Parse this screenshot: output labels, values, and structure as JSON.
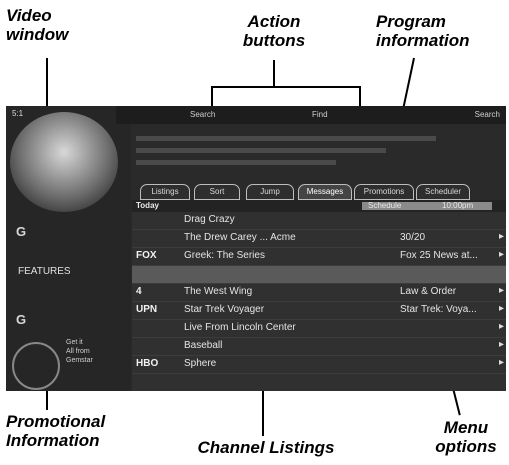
{
  "callouts": {
    "video_window": "Video\nwindow",
    "action_buttons": "Action\nbuttons",
    "program_information": "Program\ninformation",
    "promotional_information": "Promotional\nInformation",
    "channel_listings": "Channel Listings",
    "menu_options": "Menu\noptions"
  },
  "screen": {
    "clock": "5:1",
    "topbar": {
      "left": "Search",
      "middle": "Find",
      "right": "Search"
    },
    "left_panel": {
      "logo_top": "G",
      "features_label": "FEATURES",
      "logo_bottom": "G",
      "promo_text": "Get it\nAll from\nGemstar"
    },
    "tabs": [
      "Listings",
      "Sort",
      "Jump",
      "Messages",
      "Promotions",
      "Scheduler"
    ],
    "active_tab": 3,
    "time_header": {
      "day": "Today",
      "time_a": "Schedule",
      "time_b": "10:00pm"
    },
    "rows": [
      {
        "channel": "",
        "title": "Drag Crazy",
        "next": "",
        "arrow": ""
      },
      {
        "channel": "",
        "title": "The Drew Carey ... Acme",
        "next": "30/20",
        "arrow": "▸"
      },
      {
        "channel": "FOX",
        "title": "Greek: The Series",
        "next": "Fox 25 News at...",
        "arrow": "▸"
      },
      {
        "channel": "",
        "title": "",
        "next": "",
        "arrow": ""
      },
      {
        "channel": "4",
        "title": "The West Wing",
        "next": "Law & Order",
        "arrow": "▸"
      },
      {
        "channel": "UPN",
        "title": "Star Trek Voyager",
        "next": "Star Trek: Voya...",
        "arrow": "▸"
      },
      {
        "channel": "",
        "title": "Live From Lincoln Center",
        "next": "",
        "arrow": "▸"
      },
      {
        "channel": "",
        "title": "Baseball",
        "next": "",
        "arrow": "▸"
      },
      {
        "channel": "HBO",
        "title": "Sphere",
        "next": "",
        "arrow": "▸"
      }
    ]
  }
}
